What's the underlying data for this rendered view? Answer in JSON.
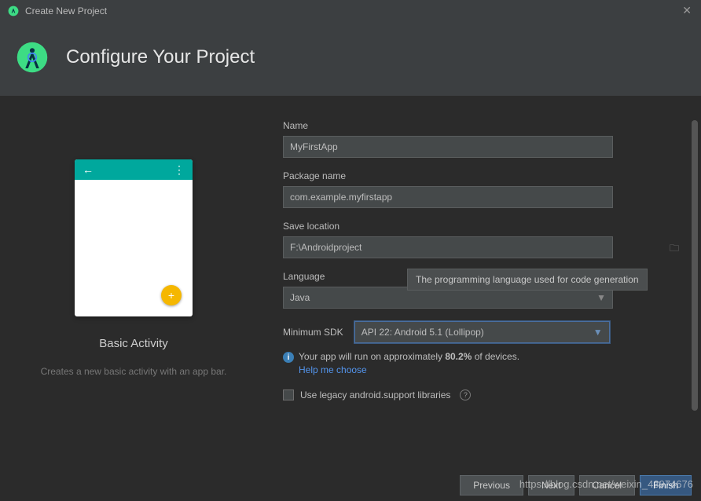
{
  "titlebar": {
    "title": "Create New Project"
  },
  "header": {
    "title": "Configure Your Project"
  },
  "preview": {
    "activity_name": "Basic Activity",
    "activity_desc": "Creates a new basic activity with an app bar."
  },
  "form": {
    "name_label": "Name",
    "name_value": "MyFirstApp",
    "package_label": "Package name",
    "package_value": "com.example.myfirstapp",
    "location_label": "Save location",
    "location_value": "F:\\Androidproject",
    "language_label": "Language",
    "language_value": "Java",
    "language_tooltip": "The programming language used for code generation",
    "sdk_label": "Minimum SDK",
    "sdk_value": "API 22: Android 5.1 (Lollipop)",
    "device_pct": "80.2%",
    "device_info_prefix": "Your app will run on approximately ",
    "device_info_suffix": " of devices.",
    "help_link": "Help me choose",
    "legacy_label": "Use legacy android.support libraries"
  },
  "footer": {
    "previous": "Previous",
    "next": "Next",
    "cancel": "Cancel",
    "finish": "Finish"
  },
  "watermark": "https://blog.csdn.net/weixin_43974676"
}
